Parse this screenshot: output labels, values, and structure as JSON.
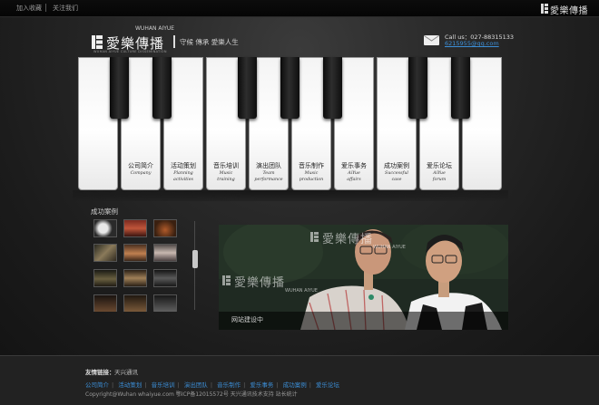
{
  "topbar": {
    "add_favorite": "加入收藏",
    "follow_us": "关注我们",
    "logo_text": "愛樂傳播"
  },
  "header": {
    "logo_cn": "愛樂傳播",
    "logo_pinyin": "WUHAN AIYUE",
    "logo_en": "WUHAN AIYUE CULTURE DISSEMINATION",
    "slogan": "守候  傳承  愛樂人生",
    "call": "Call us：027-88315133",
    "qq": "6215955@qq.com"
  },
  "piano": {
    "white_keys": [
      {
        "cn": "",
        "en": ""
      },
      {
        "cn": "公司简介",
        "en": "Company"
      },
      {
        "cn": "活动策划",
        "en": "Planning\nactivities"
      },
      {
        "cn": "音乐培训",
        "en": "Music\ntraining"
      },
      {
        "cn": "演出团队",
        "en": "Team\nperformance"
      },
      {
        "cn": "音乐制作",
        "en": "Music\nproduction"
      },
      {
        "cn": "爱乐事务",
        "en": "AiYue\naffairs"
      },
      {
        "cn": "成功案例",
        "en": "Successful\ncase"
      },
      {
        "cn": "爱乐论坛",
        "en": "AiYue\nforum"
      },
      {
        "cn": "",
        "en": ""
      }
    ]
  },
  "cases": {
    "title": "成功案例",
    "photo_caption": "网站建设中",
    "watermark_cn": "愛樂傳播",
    "watermark_py": "WUHAN AIYUE"
  },
  "footer": {
    "links_label": "友情链接：",
    "links_value": "天兴通讯",
    "nav": [
      "公司简介",
      "活动策划",
      "音乐培训",
      "演出团队",
      "音乐制作",
      "爱乐事务",
      "成功案例",
      "爱乐论坛"
    ],
    "copyright": "Copyright@Wuhan whaiyue.com  鄂ICP备12015572号  天兴通讯技术支持  站长统计"
  },
  "colors": {
    "link_blue": "#3c8fd8",
    "background": "#1c1c1c"
  }
}
